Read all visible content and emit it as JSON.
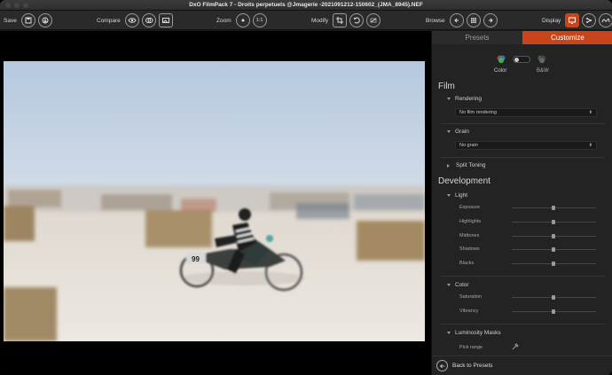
{
  "window": {
    "title": "DxO FilmPack 7 - Droits perpetuels @Jmagerie -2021091212-150602_(JMA_8945).NEF"
  },
  "toolbar": {
    "save_label": "Save",
    "compare_label": "Compare",
    "zoom_label": "Zoom",
    "zoom_one_to_one": "1:1",
    "modify_label": "Modify",
    "browse_label": "Browse",
    "display_label": "Display"
  },
  "panel": {
    "tabs": [
      {
        "label": "Presets"
      },
      {
        "label": "Customize"
      }
    ],
    "mode": {
      "color_label": "Color",
      "bw_label": "B&W"
    },
    "film": {
      "title": "Film",
      "rendering_label": "Rendering",
      "rendering_value": "No film rendering",
      "grain_label": "Grain",
      "grain_value": "No grain",
      "split_toning_label": "Split Toning"
    },
    "development": {
      "title": "Development",
      "light_label": "Light",
      "light_sliders": [
        {
          "label": "Exposure",
          "value": 0
        },
        {
          "label": "Highlights",
          "value": 0
        },
        {
          "label": "Midtones",
          "value": 0
        },
        {
          "label": "Shadows",
          "value": 0
        },
        {
          "label": "Blacks",
          "value": 0
        }
      ],
      "color_label": "Color",
      "color_sliders": [
        {
          "label": "Saturation",
          "value": 0
        },
        {
          "label": "Vibrancy",
          "value": 0
        }
      ],
      "luminosity_masks_label": "Luminosity Masks",
      "pick_range_label": "Pick range"
    },
    "footer": {
      "back_label": "Back to Presets"
    }
  },
  "photo": {
    "race_number": "99"
  },
  "colors": {
    "accent": "#c8441a",
    "panel_bg": "#232323",
    "toolbar_bg": "#2a2a2a"
  }
}
